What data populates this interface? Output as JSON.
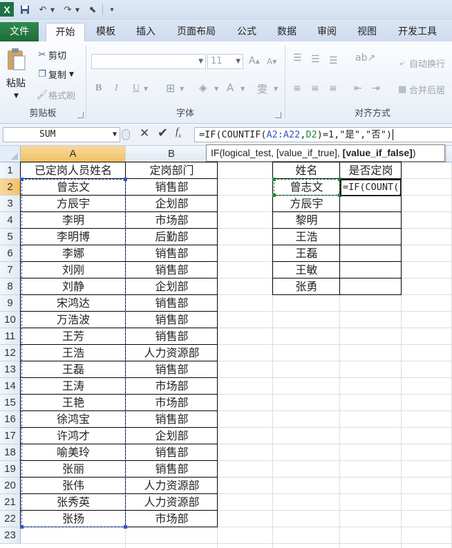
{
  "quick_access": {
    "app_icon": "X"
  },
  "tabs": [
    {
      "label": "文件"
    },
    {
      "label": "开始"
    },
    {
      "label": "模板"
    },
    {
      "label": "插入"
    },
    {
      "label": "页面布局"
    },
    {
      "label": "公式"
    },
    {
      "label": "数据"
    },
    {
      "label": "审阅"
    },
    {
      "label": "视图"
    },
    {
      "label": "开发工具"
    }
  ],
  "ribbon": {
    "clipboard": {
      "paste": "粘贴",
      "cut": "剪切",
      "copy": "复制",
      "format_painter": "格式刷",
      "group": "剪贴板"
    },
    "font": {
      "size": "11",
      "group": "字体"
    },
    "alignment": {
      "wrap_text": "自动换行",
      "merge_center": "合并后居",
      "group": "对齐方式"
    }
  },
  "formula_bar": {
    "name_box": "SUM",
    "parts": [
      "=IF(COUNTIF(",
      "A2:A22",
      ",",
      "D2",
      ")=1,\"是\",\"否\")"
    ]
  },
  "tooltip": {
    "prefix": "IF(logical_test, [value_if_true], ",
    "bold": "[value_if_false]",
    "suffix": ")"
  },
  "columns": [
    "A",
    "B"
  ],
  "rows": [
    "1",
    "2",
    "3",
    "4",
    "5",
    "6",
    "7",
    "8",
    "9",
    "10",
    "11",
    "12",
    "13",
    "14",
    "15",
    "16",
    "17",
    "18",
    "19",
    "20",
    "21",
    "22",
    "23"
  ],
  "table_main": {
    "headers": [
      "已定岗人员姓名",
      "定岗部门"
    ],
    "rows": [
      [
        "曾志文",
        "销售部"
      ],
      [
        "方辰宇",
        "企划部"
      ],
      [
        "李明",
        "市场部"
      ],
      [
        "李明博",
        "后勤部"
      ],
      [
        "李娜",
        "销售部"
      ],
      [
        "刘刚",
        "销售部"
      ],
      [
        "刘静",
        "企划部"
      ],
      [
        "宋鸿达",
        "销售部"
      ],
      [
        "万浩波",
        "销售部"
      ],
      [
        "王芳",
        "销售部"
      ],
      [
        "王浩",
        "人力资源部"
      ],
      [
        "王磊",
        "销售部"
      ],
      [
        "王涛",
        "市场部"
      ],
      [
        "王艳",
        "市场部"
      ],
      [
        "徐鸿宝",
        "销售部"
      ],
      [
        "许鸿才",
        "企划部"
      ],
      [
        "喻美玲",
        "销售部"
      ],
      [
        "张丽",
        "销售部"
      ],
      [
        "张伟",
        "人力资源部"
      ],
      [
        "张秀英",
        "人力资源部"
      ],
      [
        "张扬",
        "市场部"
      ]
    ]
  },
  "table_lookup": {
    "headers": [
      "姓名",
      "是否定岗"
    ],
    "names": [
      "曾志文",
      "方辰宇",
      "黎明",
      "王浩",
      "王磊",
      "王敏",
      "张勇"
    ],
    "active_edit": "=IF(COUNT("
  }
}
